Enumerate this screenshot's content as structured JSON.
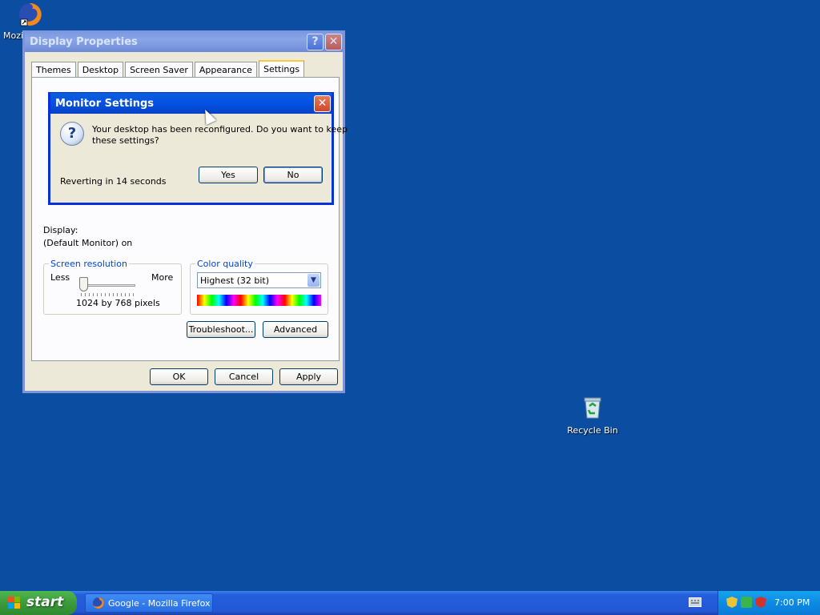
{
  "desktop": {
    "firefox_icon_label": "Mozil",
    "recycle_bin_label": "Recycle Bin"
  },
  "display_properties": {
    "title": "Display Properties",
    "help_glyph": "?",
    "close_glyph": "✕",
    "tabs": [
      {
        "label": "Themes"
      },
      {
        "label": "Desktop"
      },
      {
        "label": "Screen Saver"
      },
      {
        "label": "Appearance"
      },
      {
        "label": "Settings",
        "active": true
      }
    ],
    "display_label": "Display:",
    "display_value": "(Default Monitor) on",
    "screen_resolution": {
      "title": "Screen resolution",
      "less": "Less",
      "more": "More",
      "value_text": "1024 by 768 pixels",
      "slider_level": 0
    },
    "color_quality": {
      "title": "Color quality",
      "selected": "Highest (32 bit)"
    },
    "troubleshoot_button": "Troubleshoot...",
    "advanced_button": "Advanced",
    "ok_button": "OK",
    "cancel_button": "Cancel",
    "apply_button": "Apply"
  },
  "monitor_settings": {
    "title": "Monitor Settings",
    "close_glyph": "✕",
    "message_line1": "Your desktop has been reconfigured.  Do you want to keep",
    "message_line2": "these settings?",
    "countdown": "Reverting in 14 seconds",
    "yes_button": "Yes",
    "no_button": "No"
  },
  "taskbar": {
    "start_label": "start",
    "task_firefox": "Google - Mozilla Firefox",
    "clock": "7:00 PM"
  },
  "colors": {
    "desktop": "#0a4da1",
    "title_active": "#0554e6",
    "window_bg": "#ece9d8",
    "group_title": "#0046d5"
  }
}
